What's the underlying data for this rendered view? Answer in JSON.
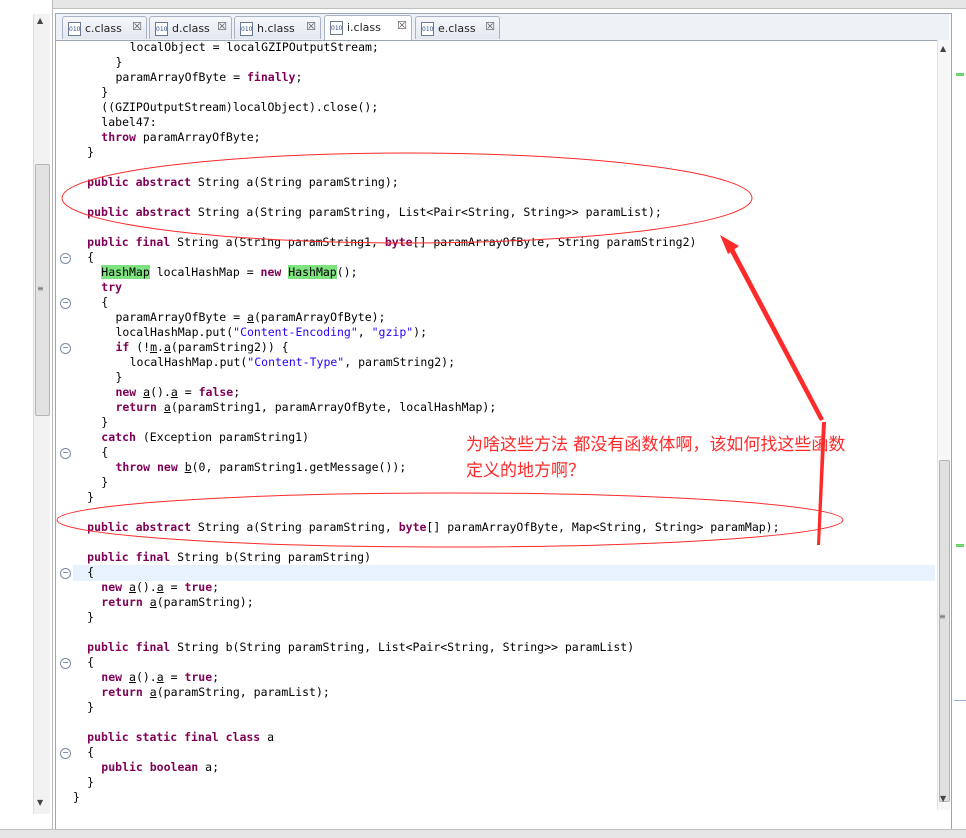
{
  "tabs": [
    {
      "label": "c.class",
      "active": false,
      "icon": "class-file-icon"
    },
    {
      "label": "d.class",
      "active": false,
      "icon": "class-file-icon"
    },
    {
      "label": "h.class",
      "active": false,
      "icon": "class-file-icon"
    },
    {
      "label": "i.class",
      "active": true,
      "icon": "class-file-icon"
    },
    {
      "label": "e.class",
      "active": false,
      "icon": "class-file-icon"
    }
  ],
  "tab_icon_text": "010",
  "close_glyph": "☒",
  "code_lines": [
    {
      "indent": 4,
      "segments": [
        {
          "t": "localObject = localGZIPOutputStream;"
        }
      ]
    },
    {
      "indent": 3,
      "segments": [
        {
          "t": "}"
        }
      ]
    },
    {
      "indent": 3,
      "segments": [
        {
          "t": "paramArrayOfByte = "
        },
        {
          "t": "finally",
          "c": "kw"
        },
        {
          "t": ";"
        }
      ]
    },
    {
      "indent": 2,
      "segments": [
        {
          "t": "}"
        }
      ]
    },
    {
      "indent": 2,
      "segments": [
        {
          "t": "((GZIPOutputStream)localObject).close();"
        }
      ]
    },
    {
      "indent": 2,
      "segments": [
        {
          "t": "label47:"
        }
      ]
    },
    {
      "indent": 2,
      "segments": [
        {
          "t": "throw",
          "c": "kw"
        },
        {
          "t": " paramArrayOfByte;"
        }
      ]
    },
    {
      "indent": 1,
      "segments": [
        {
          "t": "}"
        }
      ]
    },
    {
      "indent": 0,
      "segments": []
    },
    {
      "indent": 1,
      "segments": [
        {
          "t": "public abstract",
          "c": "kw"
        },
        {
          "t": " String a(String paramString);"
        }
      ]
    },
    {
      "indent": 0,
      "segments": []
    },
    {
      "indent": 1,
      "segments": [
        {
          "t": "public abstract",
          "c": "kw"
        },
        {
          "t": " String a(String paramString, List<Pair<String, String>> paramList);"
        }
      ]
    },
    {
      "indent": 0,
      "segments": []
    },
    {
      "indent": 1,
      "segments": [
        {
          "t": "public final",
          "c": "kw"
        },
        {
          "t": " String a(String paramString1, "
        },
        {
          "t": "byte",
          "c": "kw"
        },
        {
          "t": "[] paramArrayOfByte, String paramString2)"
        }
      ]
    },
    {
      "indent": 1,
      "segments": [
        {
          "t": "{"
        }
      ]
    },
    {
      "indent": 2,
      "segments": [
        {
          "t": "HashMap",
          "c": "hl"
        },
        {
          "t": " localHashMap = "
        },
        {
          "t": "new",
          "c": "kw"
        },
        {
          "t": " "
        },
        {
          "t": "HashMap",
          "c": "hl"
        },
        {
          "t": "();"
        }
      ]
    },
    {
      "indent": 2,
      "segments": [
        {
          "t": "try",
          "c": "kw"
        }
      ]
    },
    {
      "indent": 2,
      "segments": [
        {
          "t": "{"
        }
      ]
    },
    {
      "indent": 3,
      "segments": [
        {
          "t": "paramArrayOfByte = "
        },
        {
          "t": "a",
          "c": "ul"
        },
        {
          "t": "(paramArrayOfByte);"
        }
      ]
    },
    {
      "indent": 3,
      "segments": [
        {
          "t": "localHashMap.put("
        },
        {
          "t": "\"Content-Encoding\"",
          "c": "str"
        },
        {
          "t": ", "
        },
        {
          "t": "\"gzip\"",
          "c": "str"
        },
        {
          "t": ");"
        }
      ]
    },
    {
      "indent": 3,
      "segments": [
        {
          "t": "if",
          "c": "kw"
        },
        {
          "t": " (!"
        },
        {
          "t": "m",
          "c": "ul"
        },
        {
          "t": "."
        },
        {
          "t": "a",
          "c": "ul"
        },
        {
          "t": "(paramString2)) {"
        }
      ]
    },
    {
      "indent": 4,
      "segments": [
        {
          "t": "localHashMap.put("
        },
        {
          "t": "\"Content-Type\"",
          "c": "str"
        },
        {
          "t": ", paramString2);"
        }
      ]
    },
    {
      "indent": 3,
      "segments": [
        {
          "t": "}"
        }
      ]
    },
    {
      "indent": 3,
      "segments": [
        {
          "t": "new",
          "c": "kw"
        },
        {
          "t": " "
        },
        {
          "t": "a",
          "c": "ul"
        },
        {
          "t": "()."
        },
        {
          "t": "a",
          "c": "ul"
        },
        {
          "t": " = "
        },
        {
          "t": "false",
          "c": "kw"
        },
        {
          "t": ";"
        }
      ]
    },
    {
      "indent": 3,
      "segments": [
        {
          "t": "return",
          "c": "kw"
        },
        {
          "t": " "
        },
        {
          "t": "a",
          "c": "ul"
        },
        {
          "t": "(paramString1, paramArrayOfByte, localHashMap);"
        }
      ]
    },
    {
      "indent": 2,
      "segments": [
        {
          "t": "}"
        }
      ]
    },
    {
      "indent": 2,
      "segments": [
        {
          "t": "catch",
          "c": "kw"
        },
        {
          "t": " (Exception paramString1)"
        }
      ]
    },
    {
      "indent": 2,
      "segments": [
        {
          "t": "{"
        }
      ]
    },
    {
      "indent": 3,
      "segments": [
        {
          "t": "throw new",
          "c": "kw"
        },
        {
          "t": " "
        },
        {
          "t": "b",
          "c": "ul"
        },
        {
          "t": "(0, paramString1.getMessage());"
        }
      ]
    },
    {
      "indent": 2,
      "segments": [
        {
          "t": "}"
        }
      ]
    },
    {
      "indent": 1,
      "segments": [
        {
          "t": "}"
        }
      ]
    },
    {
      "indent": 0,
      "segments": []
    },
    {
      "indent": 1,
      "segments": [
        {
          "t": "public abstract",
          "c": "kw"
        },
        {
          "t": " String a(String paramString, "
        },
        {
          "t": "byte",
          "c": "kw"
        },
        {
          "t": "[] paramArrayOfByte, Map<String, String> paramMap);"
        }
      ]
    },
    {
      "indent": 0,
      "segments": []
    },
    {
      "indent": 1,
      "segments": [
        {
          "t": "public final",
          "c": "kw"
        },
        {
          "t": " String b(String paramString)"
        }
      ]
    },
    {
      "indent": 1,
      "segments": [
        {
          "t": "{"
        }
      ]
    },
    {
      "indent": 2,
      "segments": [
        {
          "t": "new",
          "c": "kw"
        },
        {
          "t": " "
        },
        {
          "t": "a",
          "c": "ul"
        },
        {
          "t": "()."
        },
        {
          "t": "a",
          "c": "ul"
        },
        {
          "t": " = "
        },
        {
          "t": "true",
          "c": "kw"
        },
        {
          "t": ";"
        }
      ]
    },
    {
      "indent": 2,
      "segments": [
        {
          "t": "return",
          "c": "kw"
        },
        {
          "t": " "
        },
        {
          "t": "a",
          "c": "ul"
        },
        {
          "t": "(paramString);"
        }
      ]
    },
    {
      "indent": 1,
      "segments": [
        {
          "t": "}"
        }
      ]
    },
    {
      "indent": 0,
      "segments": []
    },
    {
      "indent": 1,
      "segments": [
        {
          "t": "public final",
          "c": "kw"
        },
        {
          "t": " String b(String paramString, List<Pair<String, String>> paramList)"
        }
      ]
    },
    {
      "indent": 1,
      "segments": [
        {
          "t": "{"
        }
      ]
    },
    {
      "indent": 2,
      "segments": [
        {
          "t": "new",
          "c": "kw"
        },
        {
          "t": " "
        },
        {
          "t": "a",
          "c": "ul"
        },
        {
          "t": "()."
        },
        {
          "t": "a",
          "c": "ul"
        },
        {
          "t": " = "
        },
        {
          "t": "true",
          "c": "kw"
        },
        {
          "t": ";"
        }
      ]
    },
    {
      "indent": 2,
      "segments": [
        {
          "t": "return",
          "c": "kw"
        },
        {
          "t": " "
        },
        {
          "t": "a",
          "c": "ul"
        },
        {
          "t": "(paramString, paramList);"
        }
      ]
    },
    {
      "indent": 1,
      "segments": [
        {
          "t": "}"
        }
      ]
    },
    {
      "indent": 0,
      "segments": []
    },
    {
      "indent": 1,
      "segments": [
        {
          "t": "public static final class",
          "c": "kw"
        },
        {
          "t": " a"
        }
      ]
    },
    {
      "indent": 1,
      "segments": [
        {
          "t": "{"
        }
      ]
    },
    {
      "indent": 2,
      "segments": [
        {
          "t": "public boolean",
          "c": "kw"
        },
        {
          "t": " a;"
        }
      ]
    },
    {
      "indent": 1,
      "segments": [
        {
          "t": "}"
        }
      ]
    },
    {
      "indent": 0,
      "segments": [
        {
          "t": "}"
        }
      ]
    }
  ],
  "annotation": {
    "text": "为啥这些方法   都没有函数体啊，该如何找这些函数\n定义的地方啊？",
    "color": "#ff2a2a"
  },
  "colors": {
    "keyword": "#7f0055",
    "string": "#2a00ff",
    "highlight": "#7ee27e",
    "current_line": "#e8f2fe"
  }
}
